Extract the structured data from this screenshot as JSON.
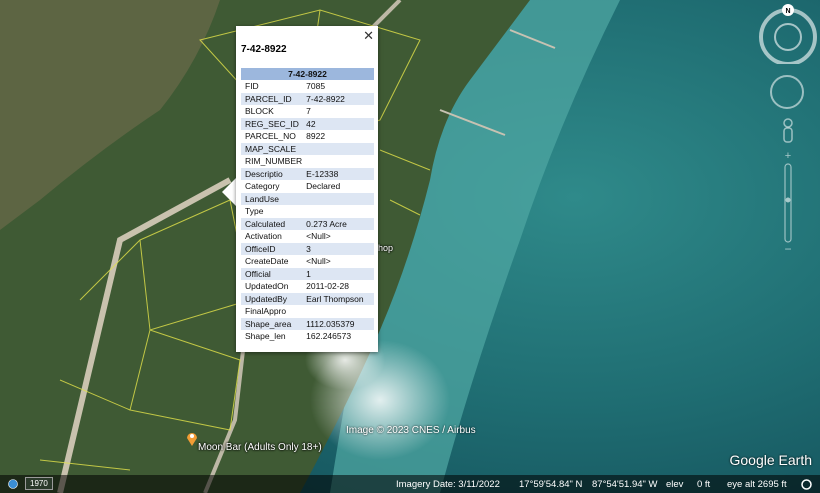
{
  "popup": {
    "title": "7-42-8922",
    "table_header": "7-42-8922",
    "close_glyph": "✕",
    "rows": [
      [
        "FID",
        "7085"
      ],
      [
        "PARCEL_ID",
        "7-42-8922"
      ],
      [
        "BLOCK",
        "7"
      ],
      [
        "REG_SEC_ID",
        "42"
      ],
      [
        "PARCEL_NO",
        "8922"
      ],
      [
        "MAP_SCALE",
        ""
      ],
      [
        "RIM_NUMBER",
        ""
      ],
      [
        "Descriptio",
        "E-12338"
      ],
      [
        "Category",
        "Declared"
      ],
      [
        "LandUse",
        ""
      ],
      [
        "Type",
        ""
      ],
      [
        "Calculated",
        "0.273 Acre"
      ],
      [
        "Activation",
        "<Null>"
      ],
      [
        "OfficeID",
        "3"
      ],
      [
        "CreateDate",
        "<Null>"
      ],
      [
        "Official",
        "1"
      ],
      [
        "UpdatedOn",
        "2011-02-28"
      ],
      [
        "UpdatedBy",
        "Earl Thompson"
      ],
      [
        "FinalAppro",
        ""
      ],
      [
        "Shape_area",
        "1112.035379"
      ],
      [
        "Shape_len",
        "162.246573"
      ]
    ]
  },
  "map_labels": {
    "shop_fragment": "hop",
    "poi": "Moon Bar (Adults Only 18+)",
    "image_credit": "Image © 2023 CNES / Airbus",
    "logo": "Google Earth"
  },
  "compass": {
    "north": "N"
  },
  "statusbar": {
    "year_badge": "1970",
    "imagery_date": "Imagery Date: 3/11/2022",
    "lat": "17°59'54.84\" N",
    "lon": "87°54'51.94\" W",
    "elev_label": "elev",
    "elev_value": "0 ft",
    "eye_alt": "eye alt  2695 ft"
  },
  "colors": {
    "water_deep": "#1f6d72",
    "water_shallow": "#3f9e9c",
    "land": "#3f5a34",
    "parcel_lines": "#e3e34a",
    "popup_header": "#9cb7dd",
    "popup_stripe": "#dde6f3",
    "poi_marker": "#f29d35"
  }
}
